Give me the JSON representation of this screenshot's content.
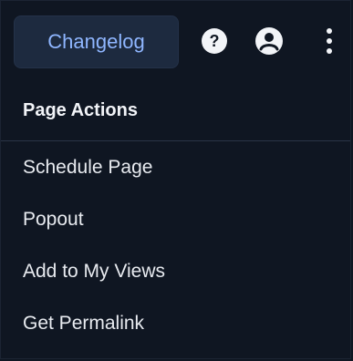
{
  "header": {
    "changelog_label": "Changelog",
    "icons": {
      "help": "help-circle-icon",
      "user": "user-circle-icon",
      "more": "more-vertical-icon"
    }
  },
  "menu": {
    "title": "Page Actions",
    "items": [
      {
        "label": "Schedule Page"
      },
      {
        "label": "Popout"
      },
      {
        "label": "Add to My Views"
      },
      {
        "label": "Get Permalink"
      }
    ]
  },
  "colors": {
    "background": "#0f1622",
    "button_bg": "#1d2a3f",
    "button_text": "#8fb6ff",
    "text": "#e8ebf0",
    "divider": "#2a3446"
  }
}
